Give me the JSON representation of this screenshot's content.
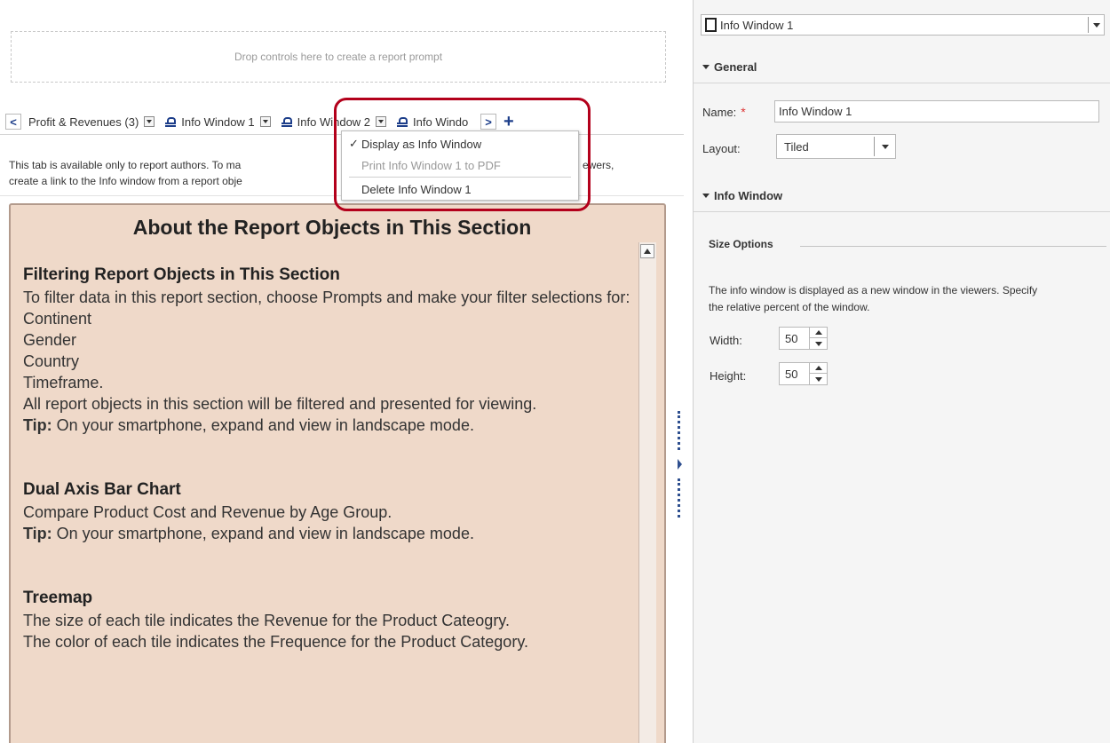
{
  "prompt_area": {
    "text": "Drop controls here to create a report prompt"
  },
  "tabs": [
    {
      "label": "Profit & Revenues (3)",
      "locked": false
    },
    {
      "label": "Info Window 1",
      "locked": true
    },
    {
      "label": "Info Window 2",
      "locked": true
    },
    {
      "label": "Info Windo",
      "locked": true
    }
  ],
  "tab_nav": {
    "prev": "<",
    "next": ">",
    "add": "+"
  },
  "info_text": {
    "line1_left": "This tab is available only to report authors.  To ma",
    "line1_right": "ewers,",
    "line2": "create a link to the Info window from a report obje"
  },
  "context_menu": {
    "items": [
      {
        "label": "Display as Info Window",
        "checked": true,
        "disabled": false
      },
      {
        "label": "Print Info Window 1 to PDF",
        "checked": false,
        "disabled": true
      },
      {
        "label": "Delete Info Window 1",
        "checked": false,
        "disabled": false
      }
    ]
  },
  "content": {
    "title": "About the Report Objects in This Section",
    "section1": {
      "heading": "Filtering Report Objects in This Section",
      "lines": [
        "To filter data in this report section, choose Prompts and make your filter selections for:",
        "Continent",
        "Gender",
        "Country",
        "Timeframe.",
        "All report objects in this section will be filtered and presented for viewing."
      ],
      "tip_label": "Tip:",
      "tip_text": " On your smartphone, expand and view in landscape mode."
    },
    "section2": {
      "heading": "Dual Axis Bar Chart",
      "line": "Compare Product Cost and Revenue by Age Group.",
      "tip_label": "Tip:",
      "tip_text": " On your smartphone, expand and view in landscape mode."
    },
    "section3": {
      "heading": "Treemap",
      "lines": [
        "The size of each tile indicates the Revenue for the Product Cateogry.",
        "The color of each tile indicates the Frequence for the Product Category."
      ]
    }
  },
  "properties": {
    "object_select": "Info Window 1",
    "general_label": "General",
    "name_label": "Name:",
    "name_value": "Info Window 1",
    "layout_label": "Layout:",
    "layout_value": "Tiled",
    "info_window_label": "Info Window",
    "size_options_label": "Size Options",
    "size_desc": "The info window is displayed as a new window in the viewers. Specify the relative percent of the window.",
    "width_label": "Width:",
    "width_value": "50",
    "height_label": "Height:",
    "height_value": "50"
  },
  "colors": {
    "highlight_border": "#b3001b",
    "content_bg": "#efd9c9",
    "accent": "#1d3e8a"
  }
}
